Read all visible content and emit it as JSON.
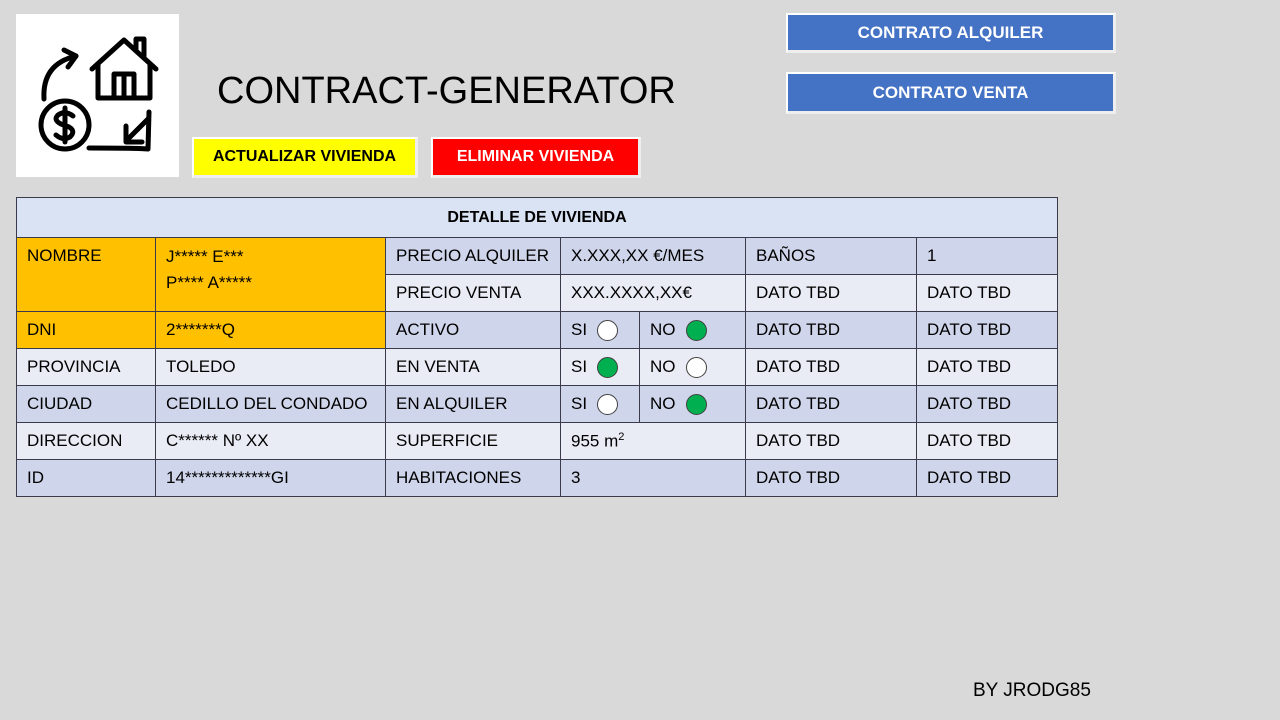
{
  "app": {
    "title": "CONTRACT-GENERATOR",
    "logo_icon": "house-money-exchange-icon",
    "credit": "BY JRODG85"
  },
  "buttons": {
    "rent_contract": "CONTRATO  ALQUILER",
    "sale_contract": "CONTRATO  VENTA",
    "update": "ACTUALIZAR VIVIENDA",
    "delete": "ELIMINAR VIVIENDA"
  },
  "colors": {
    "background": "#d9d9d9",
    "contract_button": "#4472c4",
    "update_button": "#ffff00",
    "delete_button": "#ff0000",
    "owner_highlight": "#ffc000",
    "table_header": "#dae3f3",
    "row_dark": "#cfd5ea",
    "row_light": "#e9ebf5",
    "radio_on": "#00b050"
  },
  "table": {
    "title": "DETALLE  DE VIVIENDA",
    "nombre_label": "NOMBRE",
    "nombre_line1": "J*****  E***",
    "nombre_line2": "P****  A*****",
    "precio_alquiler_label": "PRECIO  ALQUILER",
    "precio_alquiler_value": "X.XXX,XX €/MES",
    "banos_label": "BAÑOS",
    "banos_value": "1",
    "precio_venta_label": "PRECIO  VENTA",
    "precio_venta_value": "XXX.XXXX,XX€",
    "dni_label": "DNI",
    "dni_value": "2*******Q",
    "activo_label": "ACTIVO",
    "activo": {
      "si_label": "SI",
      "no_label": "NO",
      "si_checked": false,
      "no_checked": true
    },
    "provincia_label": "PROVINCIA",
    "provincia_value": "TOLEDO",
    "en_venta_label": "EN VENTA",
    "en_venta": {
      "si_label": "SI",
      "no_label": "NO",
      "si_checked": true,
      "no_checked": false
    },
    "ciudad_label": "CIUDAD",
    "ciudad_value": "CEDILLO DEL CONDADO",
    "en_alquiler_label": "EN ALQUILER",
    "en_alquiler": {
      "si_label": "SI",
      "no_label": "NO",
      "si_checked": false,
      "no_checked": true
    },
    "direccion_label": "DIRECCION",
    "direccion_value": "C******  Nº XX",
    "superficie_label": "SUPERFICIE",
    "superficie_value": "955 m",
    "superficie_unit_exp": "2",
    "id_label": "ID",
    "id_value": "14*************GI",
    "habitaciones_label": "HABITACIONES",
    "habitaciones_value": "3",
    "tbd": "DATO TBD"
  }
}
